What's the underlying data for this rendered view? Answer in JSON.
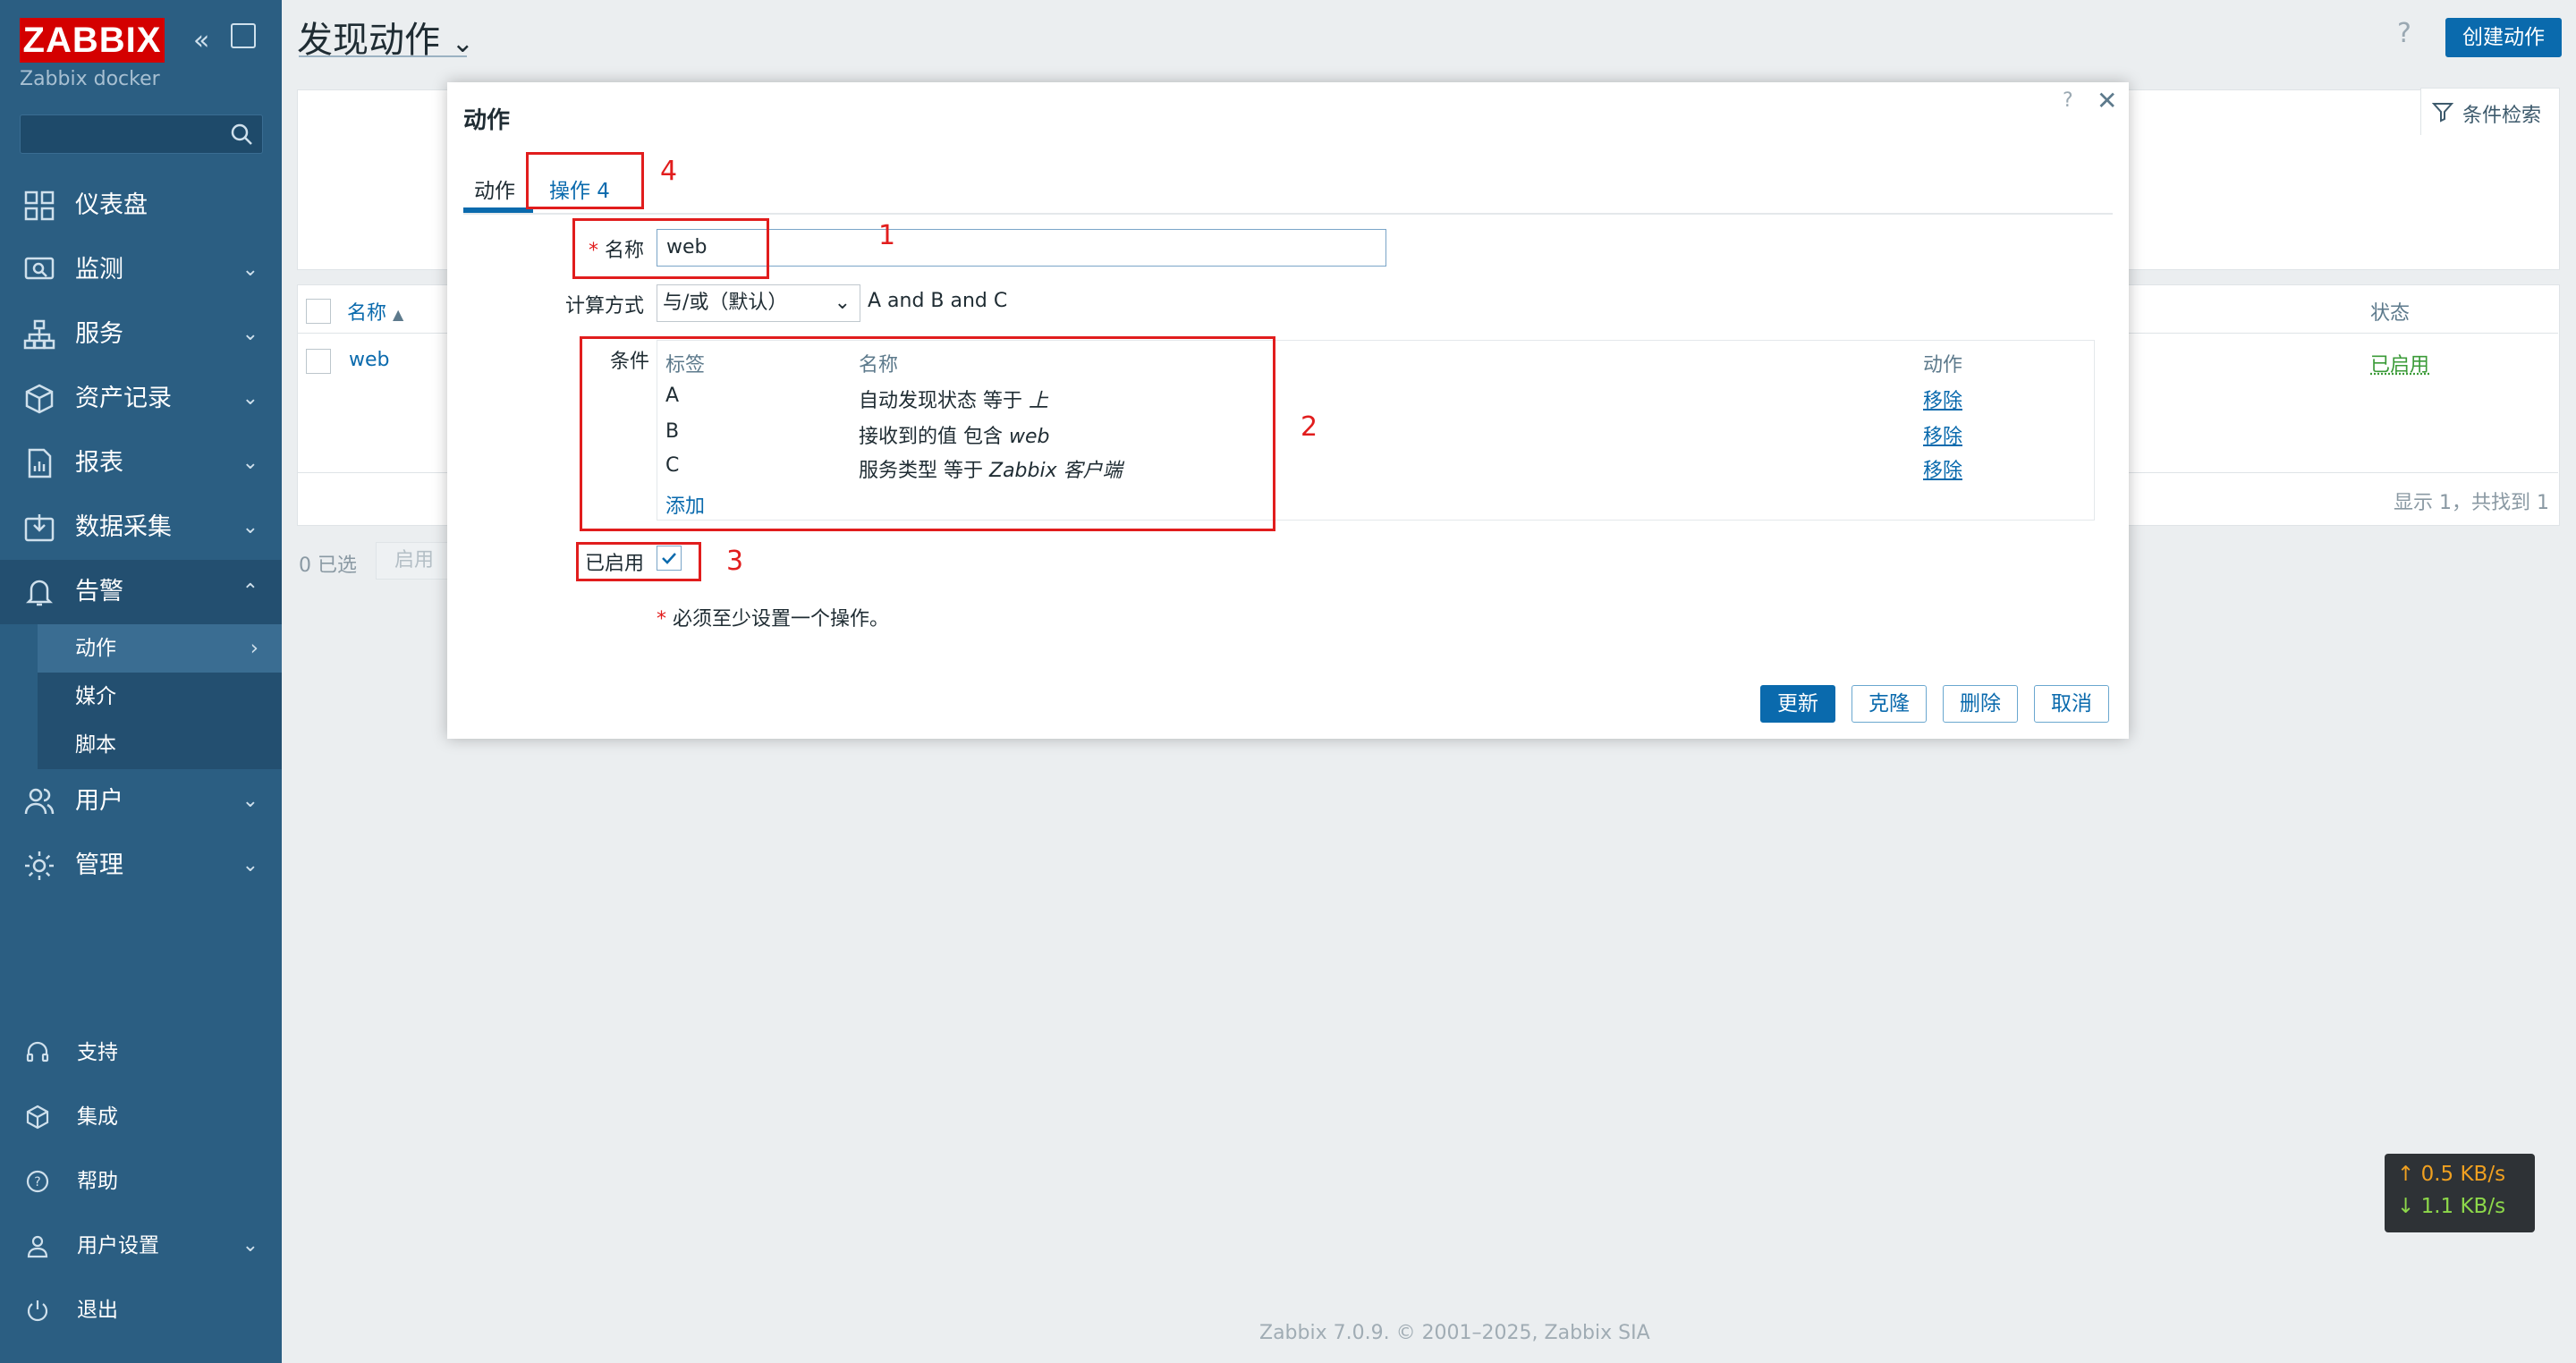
{
  "sidebar": {
    "logo": "ZABBIX",
    "subtitle": "Zabbix docker",
    "nav": [
      {
        "label": "仪表盘"
      },
      {
        "label": "监测"
      },
      {
        "label": "服务"
      },
      {
        "label": "资产记录"
      },
      {
        "label": "报表"
      },
      {
        "label": "数据采集"
      },
      {
        "label": "告警"
      },
      {
        "label": "用户"
      },
      {
        "label": "管理"
      }
    ],
    "alerts_sub": [
      {
        "label": "动作"
      },
      {
        "label": "媒介"
      },
      {
        "label": "脚本"
      }
    ],
    "bottom": [
      {
        "label": "支持"
      },
      {
        "label": "集成"
      },
      {
        "label": "帮助"
      },
      {
        "label": "用户设置"
      },
      {
        "label": "退出"
      }
    ]
  },
  "header": {
    "title": "发现动作",
    "help": "?",
    "create_button": "创建动作",
    "filter_label": "条件检索"
  },
  "list": {
    "col_name": "名称",
    "col_status": "状态",
    "rows": [
      {
        "name": "web",
        "status": "已启用"
      }
    ],
    "summary": "显示 1，共找到 1",
    "selected": "0 已选",
    "enable_button": "启用"
  },
  "modal": {
    "title": "动作",
    "help": "?",
    "close": "✕",
    "tabs": [
      {
        "label": "动作"
      },
      {
        "label": "操作 4"
      }
    ],
    "name_label": "名称",
    "required_mark": "*",
    "name_value": "web",
    "calc_label": "计算方式",
    "calc_select": "与/或（默认）",
    "calc_expr": "A and B and C",
    "conditions_label": "条件",
    "cond_head": {
      "tag": "标签",
      "name": "名称",
      "action": "动作"
    },
    "conditions": [
      {
        "tag": "A",
        "text": "自动发现状态 等于 ",
        "em": "上",
        "action": "移除"
      },
      {
        "tag": "B",
        "text": "接收到的值 包含 ",
        "em": "web",
        "action": "移除"
      },
      {
        "tag": "C",
        "text": "服务类型 等于 ",
        "em": "Zabbix 客户端",
        "action": "移除"
      }
    ],
    "add_link": "添加",
    "enabled_label": "已启用",
    "warning": "必须至少设置一个操作。",
    "buttons": {
      "update": "更新",
      "clone": "克隆",
      "delete": "删除",
      "cancel": "取消"
    },
    "annotations": [
      "1",
      "2",
      "3",
      "4"
    ]
  },
  "net": {
    "up": "↑ 0.5 KB/s",
    "down": "↓ 1.1 KB/s"
  },
  "footer": "Zabbix 7.0.9. © 2001–2025, Zabbix SIA",
  "colors": {
    "sidebar": "#2b5e82",
    "accent": "#0a6aad",
    "enabled": "#3b9b38",
    "annotation": "#e11d1d"
  }
}
